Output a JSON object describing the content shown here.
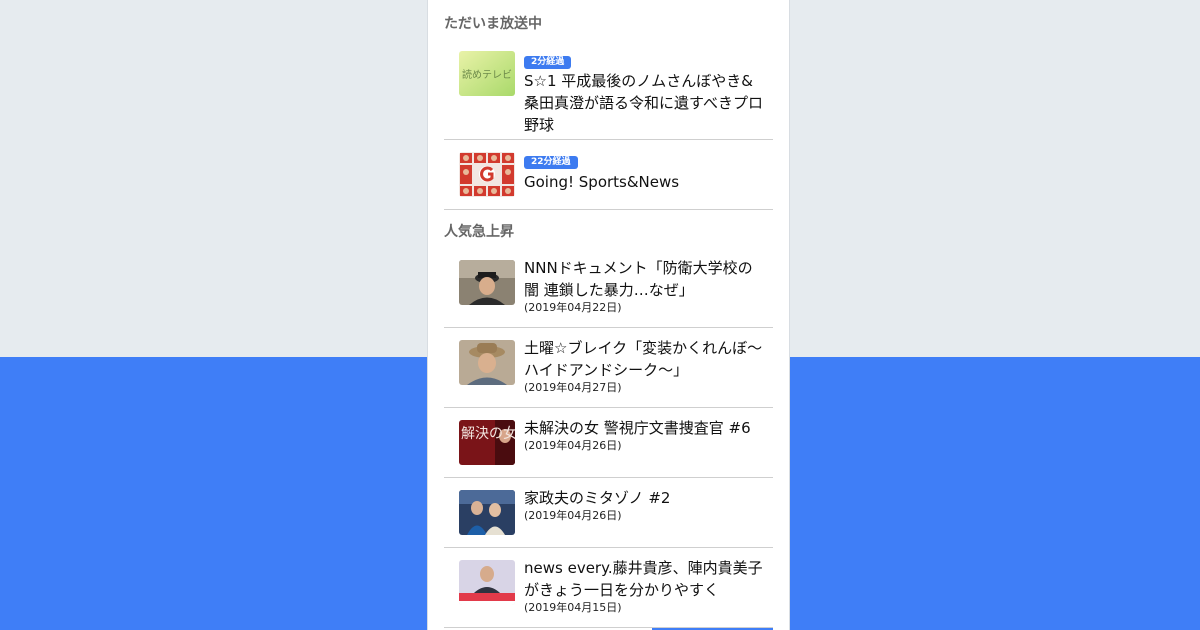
{
  "live": {
    "section_title": "ただいま放送中",
    "items": [
      {
        "badge": "2分経過",
        "title": "S☆1 平成最後のノムさんぼやき&桑田真澄が語る令和に遺すべきプロ野球",
        "thumb_icon": "yometeru-tv-logo-thumbnail"
      },
      {
        "badge": "22分経過",
        "title": "Going! Sports&News",
        "thumb_icon": "going-sports-news-thumbnail"
      }
    ]
  },
  "trending": {
    "section_title": "人気急上昇",
    "items": [
      {
        "title": "NNNドキュメント「防衛大学校の闇 連鎖した暴力…なぜ」",
        "date": "(2019年04月22日)",
        "thumb_icon": "cadet-portrait-thumbnail"
      },
      {
        "title": "土曜☆ブレイク「変装かくれんぼ～ハイドアンドシーク～」",
        "date": "(2019年04月27日)",
        "thumb_icon": "man-in-hat-thumbnail"
      },
      {
        "title": "未解決の女 警視庁文書捜査官 #6",
        "date": "(2019年04月26日)",
        "thumb_icon": "drama-poster-thumbnail",
        "thumb_text": "解決の女"
      },
      {
        "title": "家政夫のミタゾノ #2",
        "date": "(2019年04月26日)",
        "thumb_icon": "drama-scene-thumbnail"
      },
      {
        "title": "news every.藤井貴彦、陣内貴美子がきょう一日を分かりやすく",
        "date": "(2019年04月15日)",
        "thumb_icon": "news-anchor-thumbnail"
      }
    ]
  },
  "colors": {
    "accent": "#3f7ef7",
    "badge": "#3d7bf0",
    "page_bg": "#e6ebef"
  }
}
